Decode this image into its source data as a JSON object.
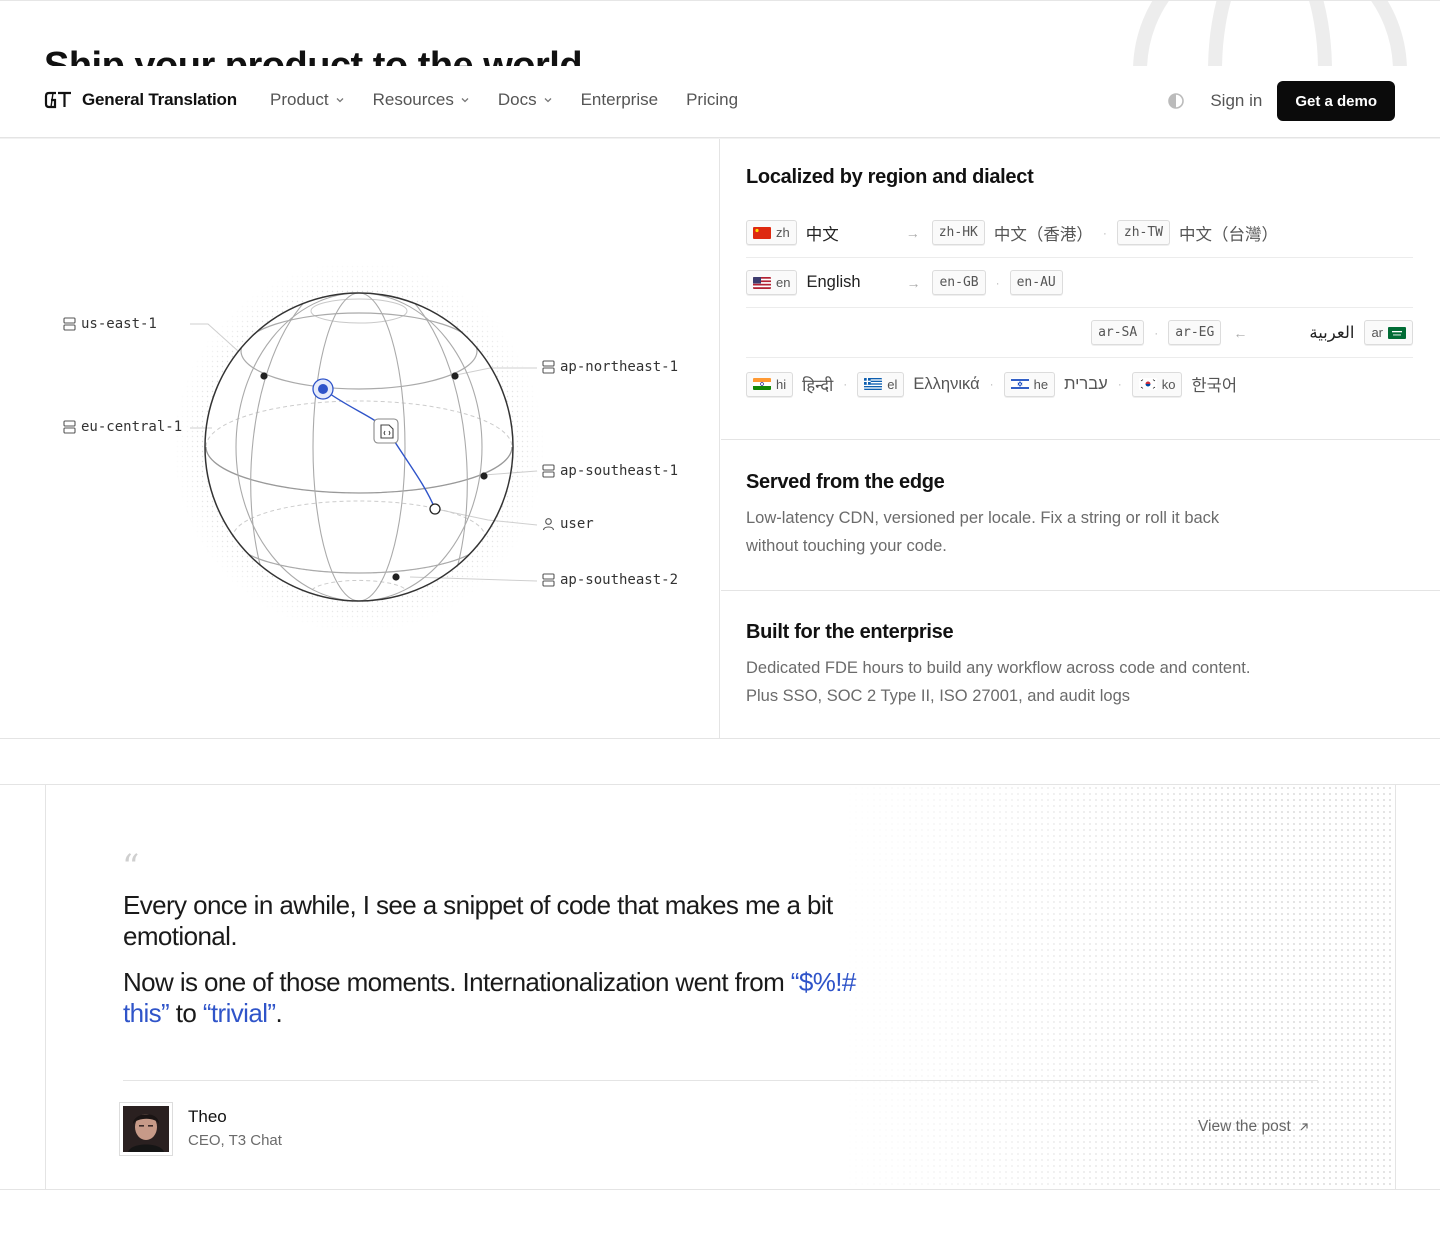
{
  "hero": {
    "partial_title": "Ship your product to the world"
  },
  "nav": {
    "brand": "General Translation",
    "items": [
      {
        "label": "Product",
        "dropdown": true
      },
      {
        "label": "Resources",
        "dropdown": true
      },
      {
        "label": "Docs",
        "dropdown": true
      },
      {
        "label": "Enterprise",
        "dropdown": false
      },
      {
        "label": "Pricing",
        "dropdown": false
      }
    ],
    "sign_in": "Sign in",
    "cta": "Get a demo"
  },
  "globe": {
    "regions": {
      "us_east_1": "us-east-1",
      "eu_central_1": "eu-central-1",
      "ap_northeast_1": "ap-northeast-1",
      "ap_southeast_1": "ap-southeast-1",
      "user": "user",
      "ap_southeast_2": "ap-southeast-2"
    },
    "accent_color": "#2f54c9"
  },
  "localization": {
    "title": "Localized by region and dialect",
    "zh": {
      "code": "zh",
      "name": "中文",
      "variants": [
        {
          "code": "zh-HK",
          "name": "中文（香港）"
        },
        {
          "code": "zh-TW",
          "name": "中文（台灣）"
        }
      ]
    },
    "en": {
      "code": "en",
      "name": "English",
      "variants": [
        {
          "code": "en-GB"
        },
        {
          "code": "en-AU"
        }
      ]
    },
    "ar": {
      "code": "ar",
      "name": "العربية",
      "variants": [
        {
          "code": "ar-SA"
        },
        {
          "code": "ar-EG"
        }
      ]
    },
    "others": [
      {
        "code": "hi",
        "name": "हिन्दी"
      },
      {
        "code": "el",
        "name": "Ελληνικά"
      },
      {
        "code": "he",
        "name": "עברית"
      },
      {
        "code": "ko",
        "name": "한국어"
      }
    ]
  },
  "edge": {
    "title": "Served from the edge",
    "line1": "Low-latency CDN, versioned per locale. Fix a string or roll it back",
    "line2": "without touching your code."
  },
  "enterprise": {
    "title": "Built for the enterprise",
    "line1": "Dedicated FDE hours to build any workflow across code and content.",
    "line2": "Plus SSO, SOC 2 Type II, ISO 27001, and audit logs"
  },
  "testimonial": {
    "quote_mark": "“",
    "p1": "Every once in awhile, I see a snippet of code that makes me a bit emotional.",
    "p2_start": "Now is one of those moments. Internationalization went from ",
    "p2_accent1": "“$%!# this”",
    "p2_mid": " to ",
    "p2_accent2": "“trivial”",
    "p2_end": ".",
    "author": "Theo",
    "role": "CEO, T3 Chat",
    "link": "View the post"
  }
}
